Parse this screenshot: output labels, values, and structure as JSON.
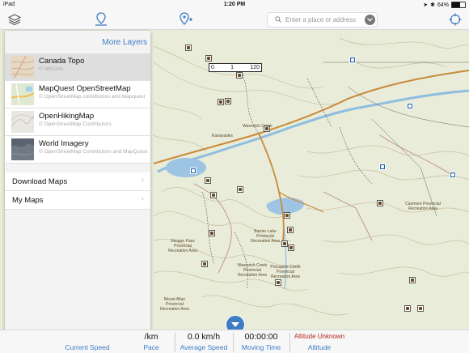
{
  "status_bar": {
    "device": "iPad",
    "time": "1:20 PM",
    "battery": "64%"
  },
  "toolbar": {
    "search_placeholder": "Enter a place or address"
  },
  "map": {
    "scale_left": "0",
    "scale_mid": "1",
    "scale_right": "120",
    "labels": [
      "Kananaskis",
      "Wasootch Creek",
      "Barrier Lake Provincial Recreation Area",
      "Porcupine Creek Provincial Recreation Area",
      "Wasootch Creek Provincial Recreation Area",
      "Skogan Pass Provincial Recreation Area",
      "Mount Allan Provincial Recreation Area",
      "Canmore Provincial Recreation Area"
    ]
  },
  "layers_panel": {
    "more_layers_label": "More Layers",
    "layers": [
      {
        "title": "Canada Topo",
        "subtitle": "© NRCAN",
        "selected": true
      },
      {
        "title": "MapQuest OpenStreetMap",
        "subtitle": "© OpenStreetMap contributors and Mapquest",
        "selected": false
      },
      {
        "title": "OpenHikingMap",
        "subtitle": "© OpenStreetMap Contributors",
        "selected": false
      },
      {
        "title": "World Imagery",
        "subtitle": "© OpenStreetMap Contributors and MapQuest",
        "selected": false
      }
    ],
    "menu": [
      {
        "label": "Download Maps"
      },
      {
        "label": "My Maps"
      }
    ]
  },
  "stats": {
    "current_speed_label": "Current Speed",
    "pace_value": "/km",
    "pace_label": "Pace",
    "average_speed_value": "0.0 km/h",
    "average_speed_label": "Average Speed",
    "moving_time_value": "00:00:00",
    "moving_time_label": "Moving Time",
    "altitude_value": "Altitude Unknown",
    "altitude_label": "Altitude"
  },
  "colors": {
    "accent": "#3d7bc4",
    "altitude_warning": "#b3261e",
    "road": "#c98a3a",
    "water": "#9ec4e4",
    "contour": "#c9b79a"
  }
}
